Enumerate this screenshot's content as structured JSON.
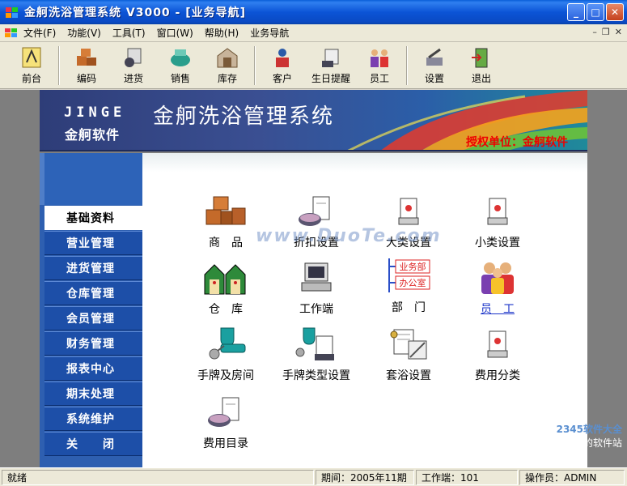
{
  "window": {
    "title": "金舸洗浴管理系统 V3000 - [业务导航]",
    "icon": "app-logo-icon"
  },
  "menu": [
    "文件(F)",
    "功能(V)",
    "工具(T)",
    "窗口(W)",
    "帮助(H)",
    "业务导航"
  ],
  "toolbar": [
    {
      "label": "前台",
      "icon": "front-desk-icon"
    },
    {
      "label": "编码",
      "icon": "boxes-icon"
    },
    {
      "label": "进货",
      "icon": "purchase-icon"
    },
    {
      "label": "销售",
      "icon": "sales-icon"
    },
    {
      "label": "库存",
      "icon": "inventory-icon"
    },
    {
      "label": "客户",
      "icon": "customer-icon"
    },
    {
      "label": "生日提醒",
      "icon": "birthday-icon"
    },
    {
      "label": "员工",
      "icon": "staff-icon"
    },
    {
      "label": "设置",
      "icon": "settings-icon"
    },
    {
      "label": "退出",
      "icon": "exit-icon"
    }
  ],
  "banner": {
    "brand_en": "JINGE",
    "brand_cn": "金舸软件",
    "title": "金舸洗浴管理系统",
    "authorized": "授权单位：金舸软件"
  },
  "nav": [
    {
      "label": "基础资料",
      "active": true
    },
    {
      "label": "营业管理"
    },
    {
      "label": "进货管理"
    },
    {
      "label": "仓库管理"
    },
    {
      "label": "会员管理"
    },
    {
      "label": "财务管理"
    },
    {
      "label": "报表中心"
    },
    {
      "label": "期末处理"
    },
    {
      "label": "系统维护"
    },
    {
      "label": "关　　闭"
    }
  ],
  "modules": [
    {
      "label": "商　品",
      "icon": "goods-boxes-icon"
    },
    {
      "label": "折扣设置",
      "icon": "discount-icon"
    },
    {
      "label": "大类设置",
      "icon": "category-major-icon"
    },
    {
      "label": "小类设置",
      "icon": "category-minor-icon"
    },
    {
      "label": "仓　库",
      "icon": "warehouse-icon"
    },
    {
      "label": "工作端",
      "icon": "workstation-icon"
    },
    {
      "label": "部　门",
      "icon": "department-icon",
      "sub": [
        "业务部",
        "办公室"
      ]
    },
    {
      "label": "员　工",
      "icon": "employees-icon",
      "link": true
    },
    {
      "label": "手牌及房间",
      "icon": "key-tag-icon"
    },
    {
      "label": "手牌类型设置",
      "icon": "key-type-icon"
    },
    {
      "label": "套浴设置",
      "icon": "bath-package-icon"
    },
    {
      "label": "费用分类",
      "icon": "expense-category-icon"
    },
    {
      "label": "费用目录",
      "icon": "expense-catalog-icon"
    }
  ],
  "watermark": "www.DuoTe.com",
  "corner_logo": "2345软件大全",
  "corner_sub": "国内最安全的软件站",
  "status": {
    "state": "就绪",
    "period": "期间：2005年11期",
    "terminal": "工作端：101",
    "operator": "操作员：ADMIN"
  },
  "colors": {
    "nav_blue": "#1d4fa8",
    "banner_blue": "#2e3d78",
    "auth_red": "#e00000"
  }
}
